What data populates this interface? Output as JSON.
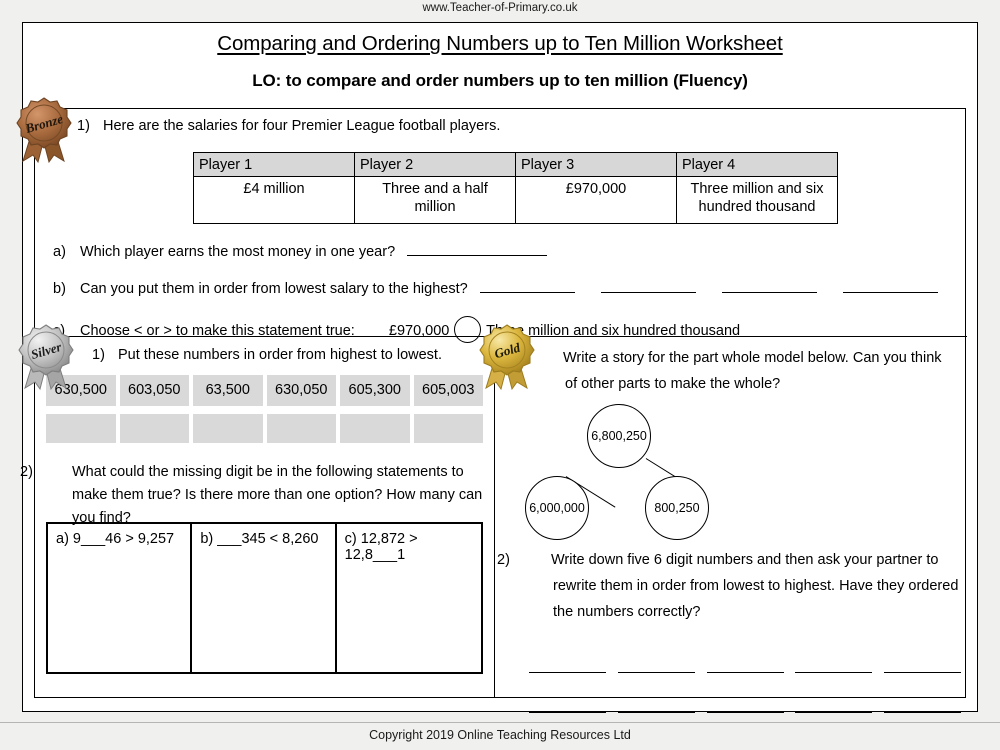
{
  "site_url": "www.Teacher-of-Primary.co.uk",
  "title": "Comparing and Ordering Numbers up to Ten Million Worksheet",
  "learning_objective": "LO: to compare and order numbers up to ten million (Fluency)",
  "bronze": {
    "badge_label": "Bronze",
    "badge_color": "#a0673c",
    "q1_number": "1)",
    "q1_text": "Here are the salaries for four Premier League football players.",
    "table": {
      "headers": [
        "Player 1",
        "Player 2",
        "Player 3",
        "Player 4"
      ],
      "values": [
        "£4 million",
        "Three and a half million",
        "£970,000",
        "Three million and six hundred thousand"
      ]
    },
    "sub_questions": [
      {
        "label": "a)",
        "text": "Which player earns the most money in one year?"
      },
      {
        "label": "b)",
        "text": "Can you put them in order from lowest salary to the highest?"
      },
      {
        "label": "c)",
        "text": "Choose < or > to make this statement true:"
      }
    ],
    "c_left_value": "£970,000",
    "c_right_value": "Three million and six hundred thousand"
  },
  "silver": {
    "badge_label": "Silver",
    "badge_color": "#b8b8b8",
    "q1_number": "1)",
    "q1_text": "Put these numbers in order from highest to lowest.",
    "numbers": [
      "630,500",
      "603,050",
      "63,500",
      "630,050",
      "605,300",
      "605,003"
    ],
    "q2_number": "2)",
    "q2_text": "What could the missing digit be in the following statements to make them true? Is there more than one option? How many can you find?",
    "digit_statements": [
      "a)  9___46 > 9,257",
      "b) ___345 <  8,260",
      "c) 12,872 > 12,8___1"
    ]
  },
  "gold": {
    "badge_label": "Gold",
    "badge_color": "#d4af37",
    "q1_number": "1)",
    "q1_text": "Write a story for the part whole model below. Can you think of other parts to make the whole?",
    "part_whole": {
      "whole": "6,800,250",
      "part_left": "6,000,000",
      "part_right": "800,250"
    },
    "q2_number": "2)",
    "q2_text": "Write down five 6 digit numbers and then ask your partner to rewrite them in order from lowest to highest. Have they ordered the numbers correctly?"
  },
  "footer": "Copyright 2019 Online Teaching Resources Ltd"
}
